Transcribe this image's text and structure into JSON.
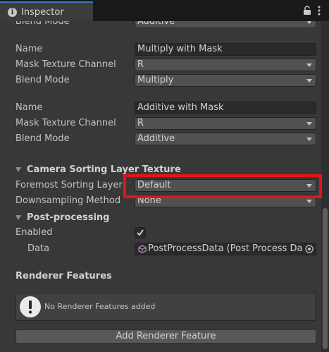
{
  "tab": {
    "title": "Inspector",
    "icon": "info-icon"
  },
  "titlebar_icons": [
    "lock-icon",
    "menu-icon"
  ],
  "blend_top": {
    "label": "Blend Mode",
    "value": "Additive"
  },
  "pass1": {
    "name_label": "Name",
    "name_value": "Multiply with Mask",
    "channel_label": "Mask Texture Channel",
    "channel_value": "R",
    "blend_label": "Blend Mode",
    "blend_value": "Multiply"
  },
  "pass2": {
    "name_label": "Name",
    "name_value": "Additive with Mask",
    "channel_label": "Mask Texture Channel",
    "channel_value": "R",
    "blend_label": "Blend Mode",
    "blend_value": "Additive"
  },
  "camera_sorting": {
    "title": "Camera Sorting Layer Texture",
    "foremost_label": "Foremost Sorting Layer",
    "foremost_value": "Default",
    "downsampling_label": "Downsampling Method",
    "downsampling_value": "None"
  },
  "postprocessing": {
    "title": "Post-processing",
    "enabled_label": "Enabled",
    "enabled": true,
    "data_label": "Data",
    "data_value": "PostProcessData (Post Process Da"
  },
  "renderer_features": {
    "title": "Renderer Features",
    "empty_message": "No Renderer Features added",
    "add_button": "Add Renderer Feature"
  },
  "colors": {
    "highlight": "#e5141a",
    "tab_accent": "#3a79bb",
    "background": "#383838"
  }
}
